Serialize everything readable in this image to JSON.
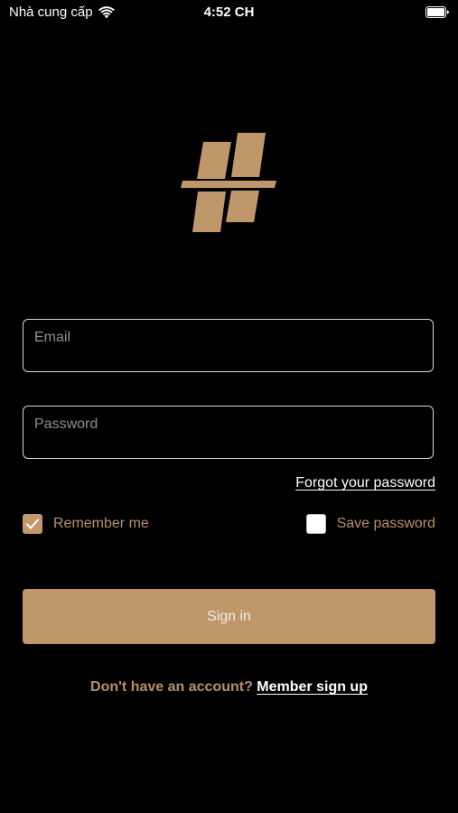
{
  "status_bar": {
    "carrier": "Nhà cung cấp",
    "time": "4:52 CH"
  },
  "login": {
    "email_placeholder": "Email",
    "password_placeholder": "Password",
    "forgot_label": "Forgot your password",
    "remember_label": "Remember me",
    "remember_checked": true,
    "save_label": "Save password",
    "save_checked": false,
    "signin_label": "Sign in",
    "signup_prompt": "Don't have an account?",
    "signup_link": "Member sign up"
  },
  "colors": {
    "background": "#000000",
    "accent": "#bf976b",
    "accent_text": "#b89068"
  },
  "icons": [
    "wifi-icon",
    "battery-icon",
    "brand-logo",
    "checkmark-icon"
  ]
}
